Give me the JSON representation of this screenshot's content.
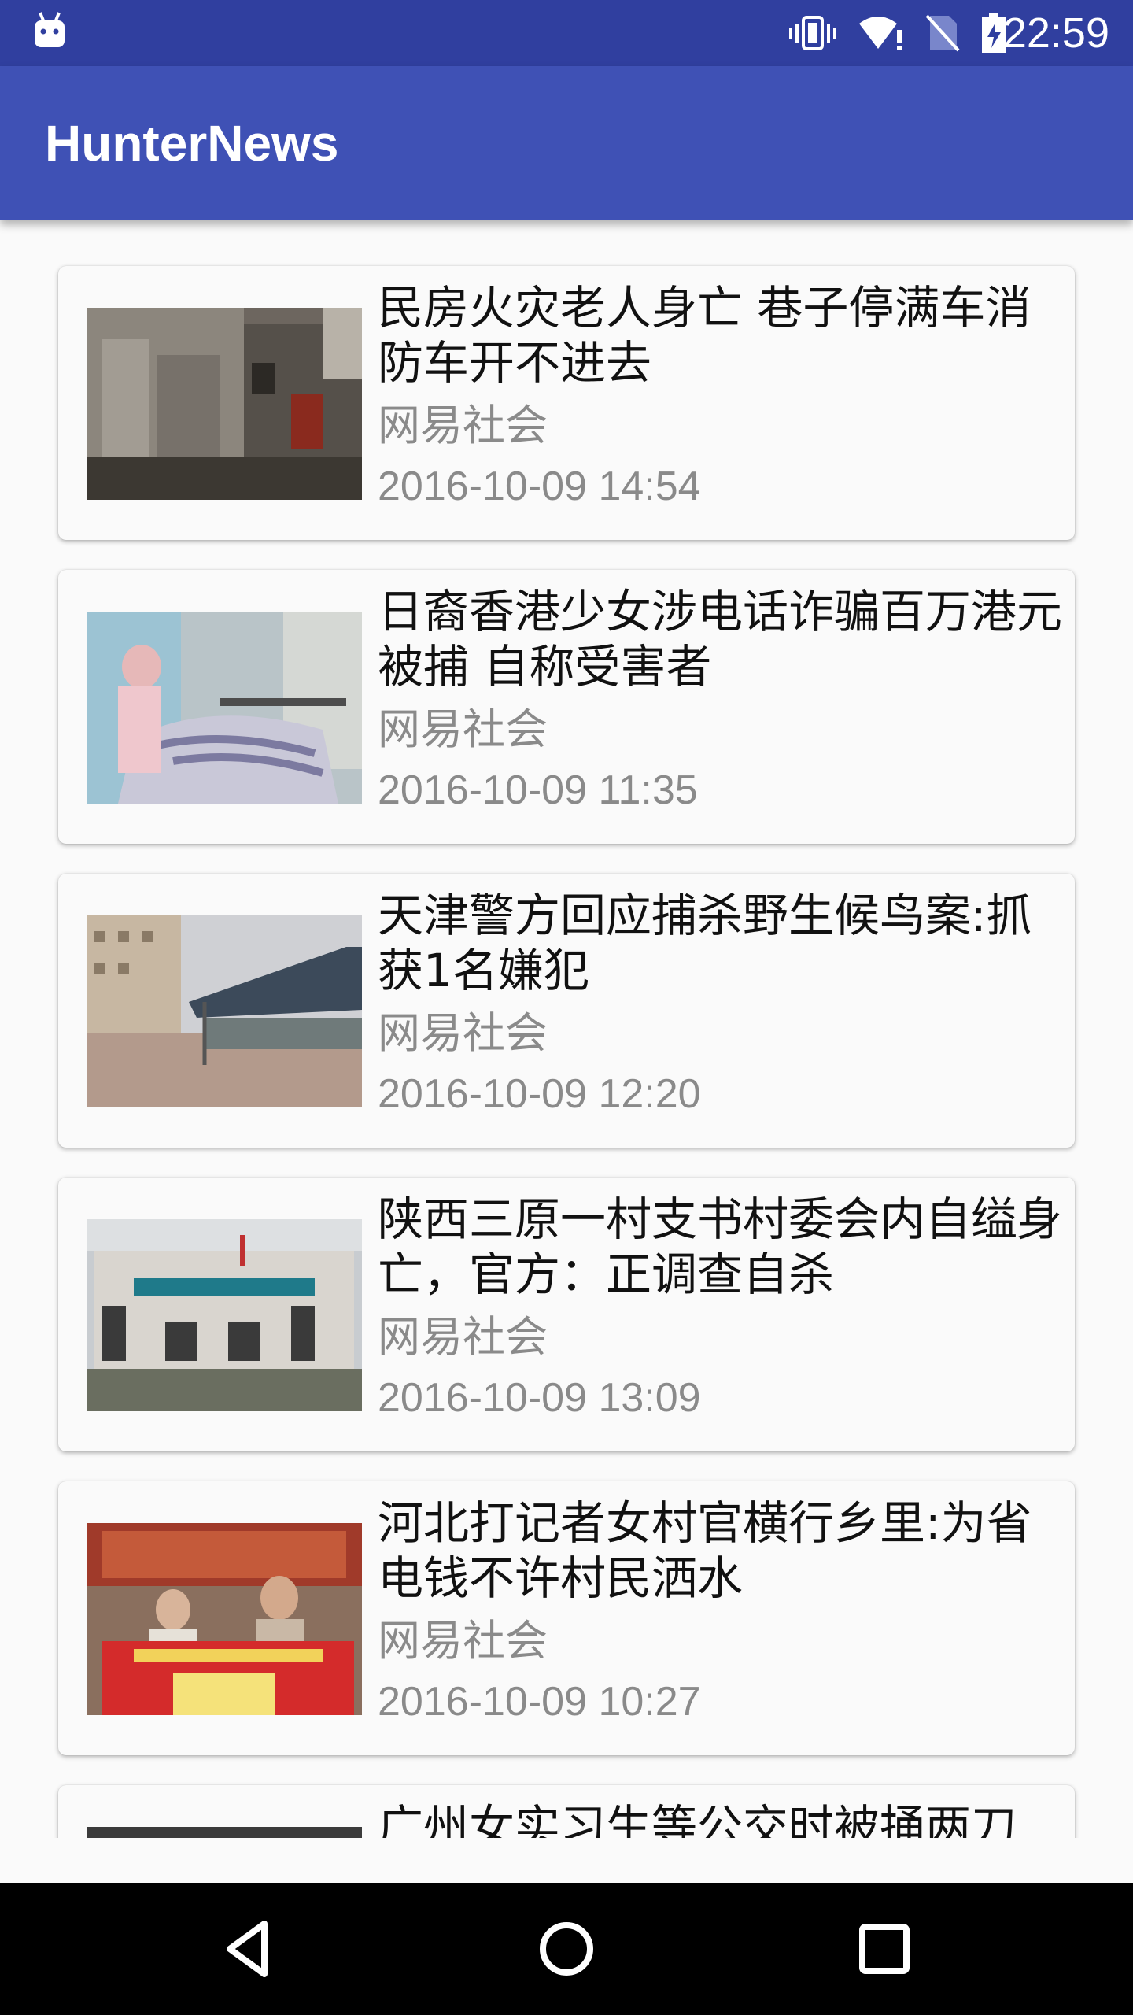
{
  "status_bar": {
    "time": "22:59",
    "icons": [
      "android-icon",
      "vibrate-icon",
      "wifi-icon",
      "no-sim-icon",
      "battery-charging-icon"
    ]
  },
  "app_bar": {
    "title": "HunterNews"
  },
  "news": [
    {
      "title": "民房火灾老人身亡 巷子停满车消防车开不进去",
      "source": "网易社会",
      "time": "2016-10-09 14:54"
    },
    {
      "title": "日裔香港少女涉电话诈骗百万港元被捕 自称受害者",
      "source": "网易社会",
      "time": "2016-10-09 11:35"
    },
    {
      "title": "天津警方回应捕杀野生候鸟案:抓获1名嫌犯",
      "source": "网易社会",
      "time": "2016-10-09 12:20"
    },
    {
      "title": "陕西三原一村支书村委会内自缢身亡，官方：正调查自杀",
      "source": "网易社会",
      "time": "2016-10-09 13:09"
    },
    {
      "title": "河北打记者女村官横行乡里:为省电钱不许村民洒水",
      "source": "网易社会",
      "time": "2016-10-09 10:27"
    },
    {
      "title": "广州女实习生等公交时被捅两刀",
      "source": "",
      "time": ""
    }
  ],
  "nav_bar": {
    "icons": [
      "back-icon",
      "home-icon",
      "recents-icon"
    ]
  },
  "colors": {
    "status_bar": "#303f9f",
    "app_bar": "#3f51b5",
    "background": "#fafafa"
  }
}
